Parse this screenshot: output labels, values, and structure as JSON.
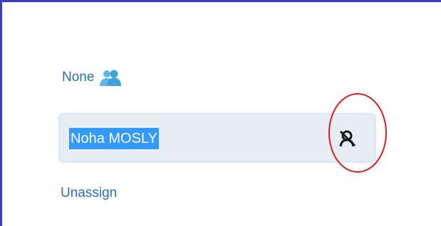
{
  "assignee": {
    "label": "None",
    "icon": "person-icon"
  },
  "search": {
    "value": "Noha MOSLY",
    "clear_icon": "remove-user-icon"
  },
  "actions": {
    "unassign_label": "Unassign"
  },
  "colors": {
    "frame_border": "#3b3bc8",
    "link": "#2a6fb0",
    "selection": "#3399ff",
    "annotation": "#e01b1b",
    "input_bg": "#e6eef3"
  }
}
